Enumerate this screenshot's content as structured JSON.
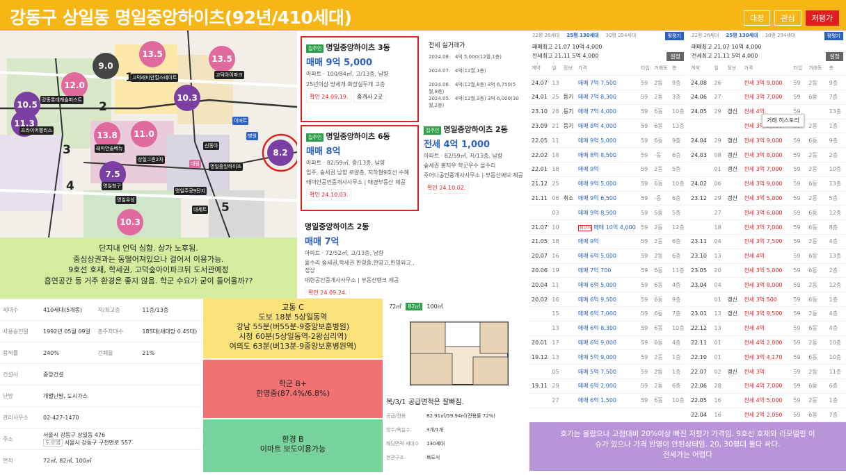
{
  "header": {
    "title": "강동구 상일동 명일중앙하이츠(92년/410세대)",
    "buttons": [
      "대장",
      "관심",
      "저평가"
    ]
  },
  "map": {
    "bubbles": [
      {
        "v": "13.5",
        "c": "#e06a9d"
      },
      {
        "v": "13.5",
        "c": "#e06a9d"
      },
      {
        "v": "9.0",
        "c": "#444"
      },
      {
        "v": "12.0",
        "c": "#e06a9d"
      },
      {
        "v": "10.3",
        "c": "#7a3fa0"
      },
      {
        "v": "10.5",
        "c": "#7a3fa0"
      },
      {
        "v": "11.3",
        "c": "#7a3fa0"
      },
      {
        "v": "13.8",
        "c": "#e06a9d"
      },
      {
        "v": "11.0",
        "c": "#e06a9d"
      },
      {
        "v": "7.5",
        "c": "#7a3fa0"
      },
      {
        "v": "8.2",
        "c": "#7a3fa0"
      },
      {
        "v": "10.3",
        "c": "#e06a9d"
      }
    ],
    "zones": [
      "1",
      "2",
      "3",
      "4",
      "5"
    ],
    "places": [
      "고덕래미안힐스테이트",
      "고덕아이파크",
      "강동롯데캐슬퍼스트",
      "상일그린2차",
      "신동아",
      "이마트",
      "명일중앙하이츠",
      "명일주공9단지",
      "병원",
      "대림",
      "프라이어팰리스",
      "래미안솔베뉴",
      "명일청구",
      "명일우성",
      "대세트"
    ]
  },
  "note": {
    "lines": [
      "단지내 언덕 심함. 상가 노후됨.",
      "중심상권과는 동떨어져있으나 걸어서 이용가능.",
      "9호선 호재, 학세권, 고덕숲아이파크뒤 도서관예정",
      "흡연공간 등 거주 환경은 좋지 않음. 학군 수요가 굳이 들어올까??"
    ]
  },
  "info": {
    "rows": [
      [
        "세대수",
        "410세대(5개동)",
        "저/최고층",
        "11층/13층"
      ],
      [
        "사용승인일",
        "1992년 05월 09일",
        "총주차대수",
        "185대(세대당 0.45대)"
      ],
      [
        "용적률",
        "240%",
        "건폐율",
        "21%"
      ],
      [
        "건설사",
        "중앙건설",
        "",
        ""
      ],
      [
        "난방",
        "개별난방, 도시가스",
        "",
        ""
      ],
      [
        "관리사무소",
        "02-427-1470",
        "",
        ""
      ],
      [
        "주소",
        "서울시 강동구 상일동 476",
        "도로명",
        "서울시 강동구 구천면로 557"
      ],
      [
        "면적",
        "72㎡, 82㎡, 100㎡",
        "",
        ""
      ]
    ]
  },
  "boxes": {
    "traffic": {
      "grade": "교통 C",
      "lines": [
        "도보 18분 5상일동역",
        "강남 55분(버55분-9중앙보훈병원)",
        "시청 60분(5상일동역-2왕십리역)",
        "여의도 63분(버13분-9중앙보훈병원역)"
      ]
    },
    "school": {
      "grade": "학군 B+",
      "lines": [
        "한영중(87.4%/6.8%)"
      ]
    },
    "env": {
      "grade": "환경 B",
      "lines": [
        "이마트 보도이용가능"
      ]
    }
  },
  "listings": [
    {
      "name": "명일중앙하이츠 3동",
      "price": "매매 9억 5,000",
      "spec": "아파트 · 100/84㎡, 고/13층, 남향",
      "feat": "25년이상 방세개 화장실두개 고층",
      "date": "확인 24.09.19.",
      "broker": "중개사 2곳"
    },
    {
      "name": "명일중앙하이츠 6동",
      "price": "매매 8억",
      "spec": "아파트 · 82/59㎡, 중/13층, 남향",
      "feat": "입주, 숲세권 남향 로얄층, 지하철9호선 수혜",
      "agent": "래미안공인중개사사무소 | 매경부동산 제공",
      "date": "확인 24.10.03."
    },
    {
      "name": "명일중앙하이츠 2동",
      "price": "매매 7억",
      "spec": "아파트 · 72/52㎡, 고/13층, 남향",
      "feat": "올수리 숲세권,학세권 한영중,한영고,한영외고 , 정상",
      "agent": "대한공인중개사사무소 | 부동산뱅크 제공",
      "date": "확인 24.09.24."
    },
    {
      "name": "명일중앙하이츠 2동",
      "price": "전세 4억 1,000",
      "spec": "아파트 · 82/59㎡, 저/13층, 남향",
      "feat": "숲세권 홍지우 학군우수 올수리",
      "agent": "주어니공인중개사사무소 | 부동산써브 제공",
      "date": "확인 24.10.02."
    }
  ],
  "deals": {
    "title": "전세 실거래가",
    "rows": [
      [
        "2024.08.",
        "4억 5,000(12월,1층)"
      ],
      [
        "2024.07.",
        "4억(12월,1층)"
      ],
      [
        "2024.06.",
        "4억(12월,8층)",
        "3억 6,750(5월,8층)"
      ],
      [
        "2024.05.",
        "4억(12월,3층)",
        "3억 6,000(30월,2층)"
      ]
    ]
  },
  "floorplan": {
    "tabs": [
      "72㎡",
      "82㎡",
      "100㎡"
    ],
    "caption": "복/3/1 공급면적은 잘빠짐.",
    "details": [
      [
        "공급/전용",
        "82.91㎡/59.94㎡(전용률 72%)"
      ],
      [
        "방수/욕실수",
        "3개/1개"
      ],
      [
        "해당면적 세대수",
        "130세대"
      ],
      [
        "현관구조",
        "복도식"
      ]
    ]
  },
  "trade_left": {
    "size_tabs": [
      "22평 26세대",
      "25평 130세대",
      "30평 254세대"
    ],
    "summary": [
      "매매최고 21.07 10억 4,000",
      "전세최고 21.11 5억 4,000"
    ],
    "btn": "평평기",
    "btn2": "설정",
    "cols": [
      "계약",
      "일",
      "정보",
      "가격",
      "타입",
      "거래동",
      "층"
    ],
    "rows": [
      [
        "24.07",
        "13",
        "",
        "매매 7억 7,500",
        "59",
        "2동",
        "9층"
      ],
      [
        "24.01",
        "25",
        "등기",
        "매매 7억 8,300",
        "59",
        "2동",
        "3층"
      ],
      [
        "23.10",
        "28",
        "등기",
        "매매 7억 4,000",
        "59",
        "6동",
        "10층"
      ],
      [
        "23.09",
        "21",
        "등기",
        "매매 8억 4,000",
        "59",
        "6동",
        "13층"
      ],
      [
        "22.05",
        "11",
        "",
        "매매 9억 5,000",
        "59",
        "6동",
        "9층"
      ],
      [
        "22.02",
        "18",
        "",
        "매매 8억 8,500",
        "59",
        "-동",
        "6층"
      ],
      [
        "22.01",
        "18",
        "",
        "매매 9억",
        "59",
        "2동",
        "5층"
      ],
      [
        "21.12",
        "25",
        "",
        "매매 9억 5,000",
        "59",
        "6동",
        "10층"
      ],
      [
        "21.11",
        "06",
        "취소",
        "매매 9억 6,500",
        "59",
        "-동",
        "6층"
      ],
      [
        "",
        "03",
        "",
        "매매 9억 8,500",
        "59",
        "5동",
        "5층"
      ],
      [
        "21.07",
        "10",
        "",
        "매매 10억 4,000",
        "59",
        "2동",
        "12층"
      ],
      [
        "21.05",
        "18",
        "",
        "매매 9억",
        "59",
        "2동",
        "6층"
      ],
      [
        "20.07",
        "16",
        "",
        "매매 6억 5,000",
        "59",
        "2동",
        "6층"
      ],
      [
        "20.06",
        "19",
        "",
        "매매 7억 700",
        "59",
        "6동",
        "11층"
      ],
      [
        "20.04",
        "11",
        "",
        "매매 6억 5,000",
        "59",
        "6동",
        "4층"
      ],
      [
        "20.02",
        "16",
        "",
        "매매 6억 9,500",
        "59",
        "6동",
        "9층"
      ],
      [
        "",
        "15",
        "",
        "매매 6억 7,000",
        "59",
        "6동",
        "7층"
      ],
      [
        "",
        "13",
        "",
        "매매 6억 8,300",
        "59",
        "6동",
        "10층"
      ],
      [
        "20.01",
        "17",
        "",
        "매매 6억 9,000",
        "59",
        "6동",
        "4층"
      ],
      [
        "19.12",
        "13",
        "",
        "매매 5억 9,000",
        "59",
        "2동",
        "1층"
      ],
      [
        "",
        "05",
        "",
        "매매 5억 7,500",
        "59",
        "2동",
        "1층"
      ],
      [
        "19.11",
        "29",
        "",
        "매매 6억 2,000",
        "59",
        "2동",
        "6층"
      ],
      [
        "",
        "27",
        "",
        "매매 6억 1,500",
        "59",
        "6동",
        "10층"
      ]
    ],
    "badge": "최고가"
  },
  "trade_right": {
    "size_tabs": [
      "22평 26세대",
      "25평 130세대",
      "30평 254세대"
    ],
    "summary": [
      "매매최고 21.07 10억 4,000",
      "전세최고 21.11 5억 4,000"
    ],
    "btn": "평평기",
    "btn2": "설정",
    "tooltip": "거래 히스토리",
    "rows": [
      [
        "24.08",
        "26",
        "",
        "전세 3억 9,000",
        "59",
        "2동",
        "9층"
      ],
      [
        "24.06",
        "27",
        "",
        "전세 3억 7,000",
        "59",
        "6동",
        "7층"
      ],
      [
        "24.05",
        "29",
        "갱신",
        "전세 4억",
        "59",
        "",
        "13층"
      ],
      [
        "",
        "",
        "",
        "전세 3억 5,000",
        "59",
        "2동",
        "1층"
      ],
      [
        "24.04",
        "29",
        "갱신",
        "전세 3억 9,000",
        "59",
        "6동",
        "9층"
      ],
      [
        "24.03",
        "08",
        "갱신",
        "전세 3억 8,000",
        "59",
        "2동",
        "2층"
      ],
      [
        "",
        "01",
        "갱신",
        "전세 3억 7,000",
        "59",
        "2동",
        "10층"
      ],
      [
        "24.02",
        "06",
        "",
        "전세 3억 9,000",
        "59",
        "6동",
        "13층"
      ],
      [
        "23.12",
        "29",
        "갱신",
        "전세 3억 5,000",
        "59",
        "2동",
        "5층"
      ],
      [
        "",
        "27",
        "",
        "전세 3억 6,000",
        "59",
        "6동",
        "12층"
      ],
      [
        "",
        "18",
        "",
        "전세 3억 7,000",
        "59",
        "6동",
        "8층"
      ],
      [
        "23.11",
        "04",
        "",
        "전세 3억 7,500",
        "59",
        "2동",
        "4층"
      ],
      [
        "23.10",
        "13",
        "",
        "전세 4억",
        "59",
        "6동",
        "13층"
      ],
      [
        "23.05",
        "20",
        "",
        "전세 3억 5,000",
        "59",
        "6동",
        "2층"
      ],
      [
        "23.04",
        "04",
        "",
        "전세 3억 8,000",
        "59",
        "2동",
        "12층"
      ],
      [
        "",
        "01",
        "갱신",
        "전세 3억 500",
        "59",
        "6동",
        "1층"
      ],
      [
        "23.01",
        "13",
        "갱신",
        "전세 3억 9,500",
        "59",
        "2동",
        "4층"
      ],
      [
        "22.12",
        "13",
        "",
        "전세 4억",
        "59",
        "6동",
        "4층"
      ],
      [
        "22.11",
        "01",
        "",
        "전세 4억 2,000",
        "59",
        "2동",
        "10층"
      ],
      [
        "22.10",
        "01",
        "",
        "전세 3억 4,170",
        "59",
        "6동",
        "10층"
      ],
      [
        "22.07",
        "02",
        "갱신",
        "전세 3억",
        "59",
        "2동",
        "11층"
      ],
      [
        "22.06",
        "28",
        "",
        "전세 4억 7,000",
        "59",
        "6동",
        "6층"
      ],
      [
        "22.05",
        "16",
        "",
        "전세 4억 5,000",
        "59",
        "2동",
        "1층"
      ],
      [
        "22.04",
        "16",
        "",
        "전세 2억 2,050",
        "59",
        "6동",
        "7층"
      ]
    ]
  },
  "summary_note": {
    "lines": [
      "호가는 올랐으나 고점대비 20%이상 빠진 저평가 가격임. 9호선 호재와 리모델링 이",
      "슈가 있으나 가격 반영이 안된상태임. 20, 30평대 둘다 싸다.",
      "전세가는 어렵다"
    ]
  }
}
